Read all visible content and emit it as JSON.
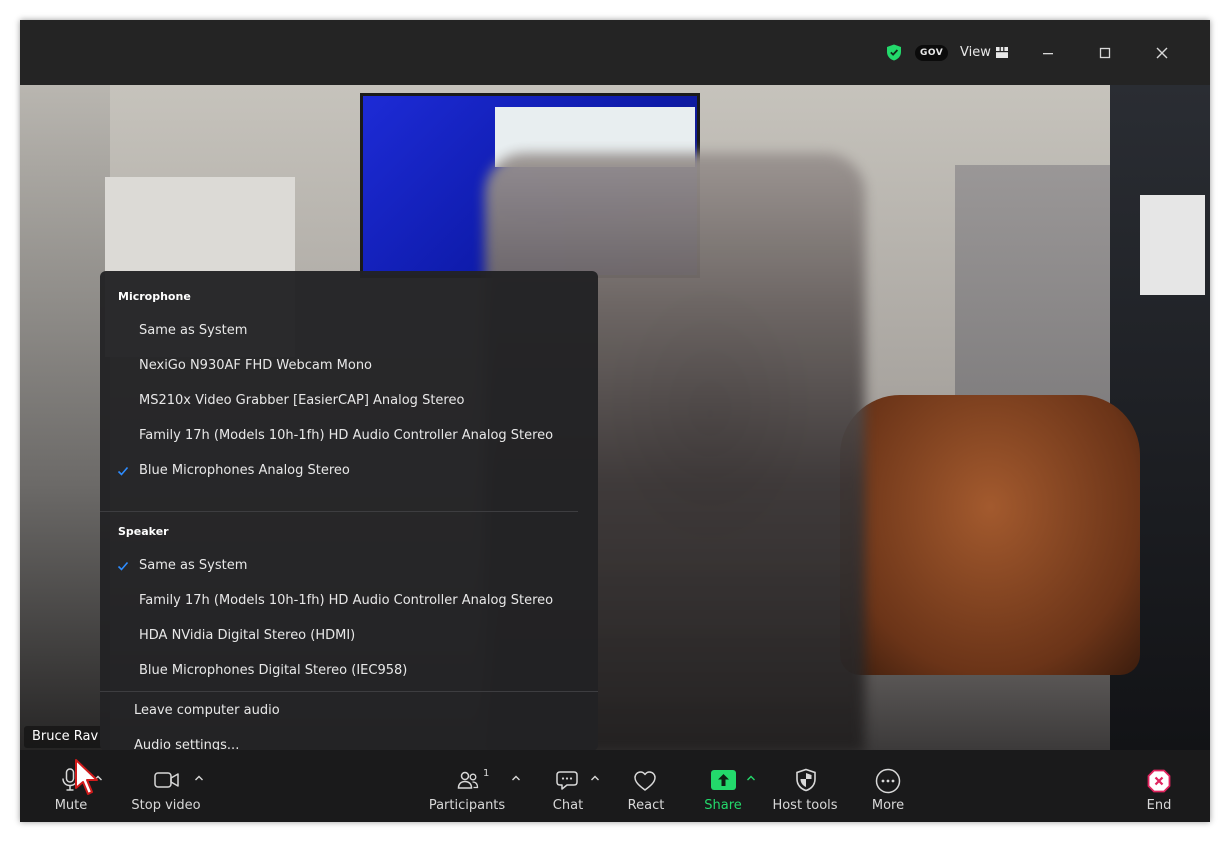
{
  "titlebar": {
    "badge": "GOV",
    "view_label": "View"
  },
  "video": {
    "participant_name": "Bruce Rav"
  },
  "audio_menu": {
    "microphone_header": "Microphone",
    "microphone_items": [
      {
        "label": "Same as System",
        "checked": false
      },
      {
        "label": "NexiGo N930AF FHD Webcam Mono",
        "checked": false
      },
      {
        "label": "MS210x Video Grabber [EasierCAP] Analog Stereo",
        "checked": false
      },
      {
        "label": "Family 17h (Models 10h-1fh) HD Audio Controller Analog Stereo",
        "checked": false
      },
      {
        "label": "Blue Microphones Analog Stereo",
        "checked": true
      }
    ],
    "speaker_header": "Speaker",
    "speaker_items": [
      {
        "label": "Same as System",
        "checked": true
      },
      {
        "label": "Family 17h (Models 10h-1fh) HD Audio Controller Analog Stereo",
        "checked": false
      },
      {
        "label": "HDA NVidia Digital Stereo (HDMI)",
        "checked": false
      },
      {
        "label": "Blue Microphones Digital Stereo (IEC958)",
        "checked": false
      }
    ],
    "leave_audio": "Leave computer audio",
    "audio_settings": "Audio settings..."
  },
  "toolbar": {
    "mute": "Mute",
    "stop_video": "Stop video",
    "participants": "Participants",
    "participants_count": "1",
    "chat": "Chat",
    "react": "React",
    "share": "Share",
    "host_tools": "Host tools",
    "more": "More",
    "end": "End"
  },
  "colors": {
    "accent_green": "#23d96b",
    "check_blue": "#2d8cff",
    "end_red": "#e0245e"
  }
}
